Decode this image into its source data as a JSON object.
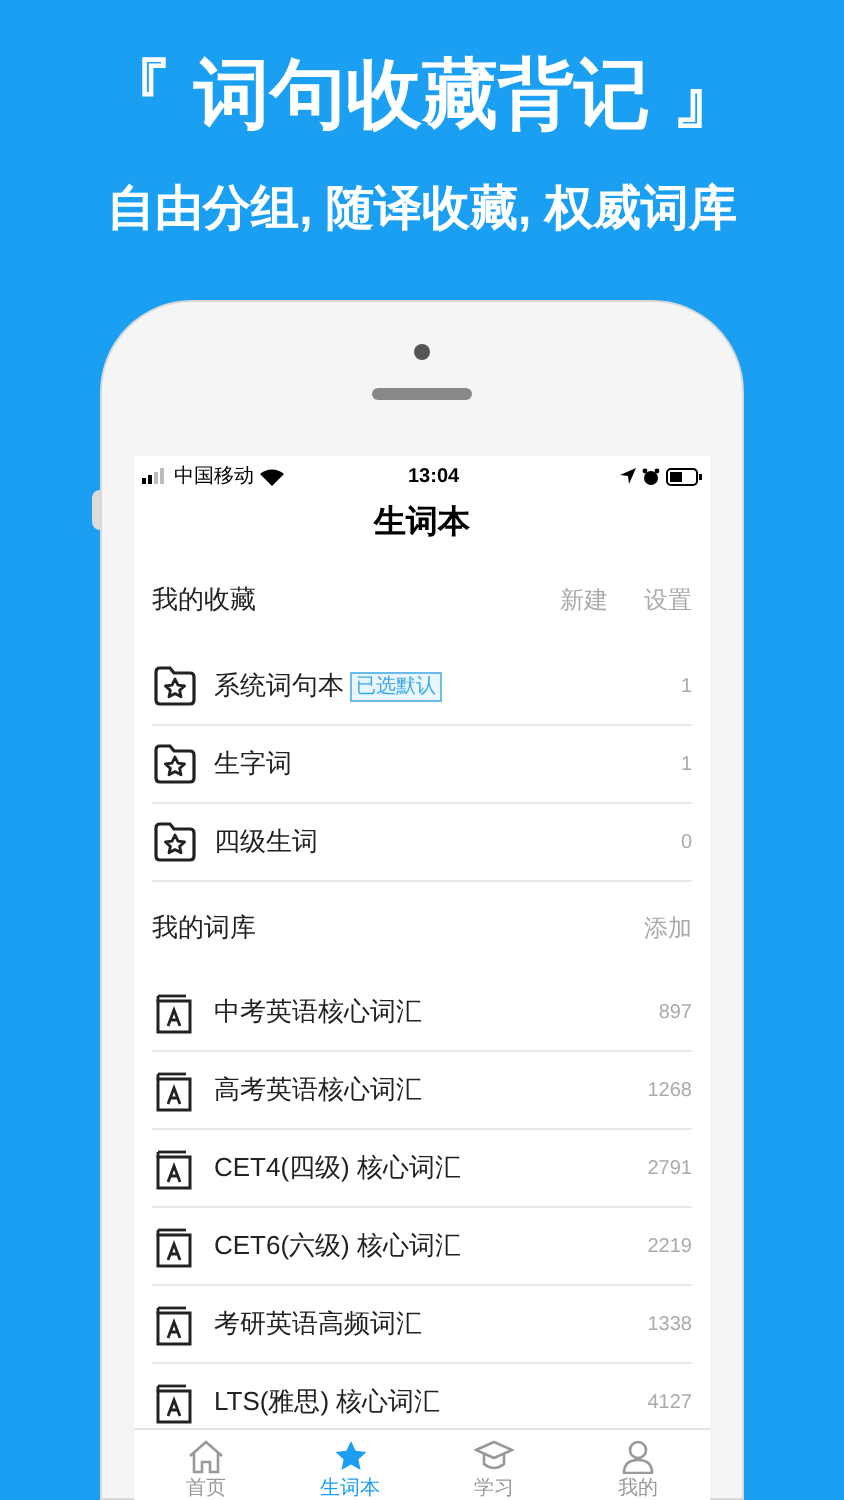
{
  "headline": "『 词句收藏背记 』",
  "subheadline": "自由分组, 随译收藏, 权威词库",
  "status_bar": {
    "carrier": "中国移动",
    "time": "13:04"
  },
  "title": "生词本",
  "favorites": {
    "title": "我的收藏",
    "actions": [
      "新建",
      "设置"
    ],
    "items": [
      {
        "name": "系统词句本",
        "badge": "已选默认",
        "count": "1"
      },
      {
        "name": "生字词",
        "count": "1"
      },
      {
        "name": "四级生词",
        "count": "0"
      }
    ]
  },
  "libraries": {
    "title": "我的词库",
    "actions": [
      "添加"
    ],
    "items": [
      {
        "name": "中考英语核心词汇",
        "count": "897"
      },
      {
        "name": "高考英语核心词汇",
        "count": "1268"
      },
      {
        "name": "CET4(四级) 核心词汇",
        "count": "2791"
      },
      {
        "name": "CET6(六级) 核心词汇",
        "count": "2219"
      },
      {
        "name": "考研英语高频词汇",
        "count": "1338"
      },
      {
        "name": "LTS(雅思) 核心词汇",
        "count": "4127"
      }
    ]
  },
  "tab_bar": [
    {
      "label": "首页",
      "kind": "home",
      "selected": false
    },
    {
      "label": "生词本",
      "kind": "star",
      "selected": true
    },
    {
      "label": "学习",
      "kind": "cap",
      "selected": false
    },
    {
      "label": "我的",
      "kind": "person",
      "selected": false
    }
  ]
}
